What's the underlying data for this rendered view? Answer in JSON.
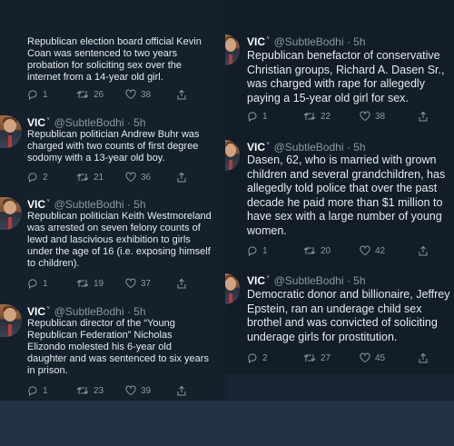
{
  "tweets": {
    "left": [
      {
        "name": "",
        "verified": "",
        "handle": "",
        "time": "",
        "text": "Republican election board official Kevin\nCoan was sentenced to two years\nprobation for soliciting sex over the\ninternet from a 14-year old girl.",
        "replies": "1",
        "retweets": "26",
        "likes": "38"
      },
      {
        "name": "VIC",
        "verified": "ᵛ",
        "handle": "@SubtleBodhi",
        "time": "· 5h",
        "text": "Republican politician Andrew Buhr was\ncharged with two counts of first degree\nsodomy with a 13-year old boy.",
        "replies": "2",
        "retweets": "21",
        "likes": "36"
      },
      {
        "name": "VIC",
        "verified": "ᵛ",
        "handle": "@SubtleBodhi",
        "time": "· 5h",
        "text": "Republican politician Keith Westmoreland\nwas arrested on seven felony counts of\nlewd and lascivious exhibition to girls\nunder the age of 16 (i.e. exposing himself\nto children).",
        "replies": "1",
        "retweets": "19",
        "likes": "37"
      },
      {
        "name": "VIC",
        "verified": "ᵛ",
        "handle": "@SubtleBodhi",
        "time": "· 5h",
        "text": "Republican director of the “Young\nRepublican Federation” Nicholas\nElizondo molested his 6-year old\ndaughter and was sentenced to six years\nin prison.",
        "replies": "1",
        "retweets": "23",
        "likes": "39"
      }
    ],
    "right": [
      {
        "name": "VIC",
        "verified": "ᵛ",
        "handle": "@SubtleBodhi",
        "time": "· 5h",
        "text": "Republican benefactor of conservative\nChristian groups, Richard A. Dasen Sr.,\nwas charged with rape for allegedly\npaying a 15-year old girl for sex.",
        "replies": "1",
        "retweets": "22",
        "likes": "38"
      },
      {
        "name": "VIC",
        "verified": "ᵛ",
        "handle": "@SubtleBodhi",
        "time": "· 5h",
        "text": "Dasen, 62, who is married with grown\nchildren and several grandchildren, has\nallegedly told police that over the past\ndecade he paid more than $1 million to\nhave sex with a large number of young\nwomen.",
        "replies": "1",
        "retweets": "20",
        "likes": "42"
      },
      {
        "name": "VIC",
        "verified": "ᵛ",
        "handle": "@SubtleBodhi",
        "time": "· 5h",
        "text": "Democratic donor and billionaire, Jeffrey\nEpstein, ran an underage child sex\nbrothel and was convicted of soliciting\nunderage girls for prostitution.",
        "replies": "2",
        "retweets": "27",
        "likes": "45"
      }
    ]
  }
}
